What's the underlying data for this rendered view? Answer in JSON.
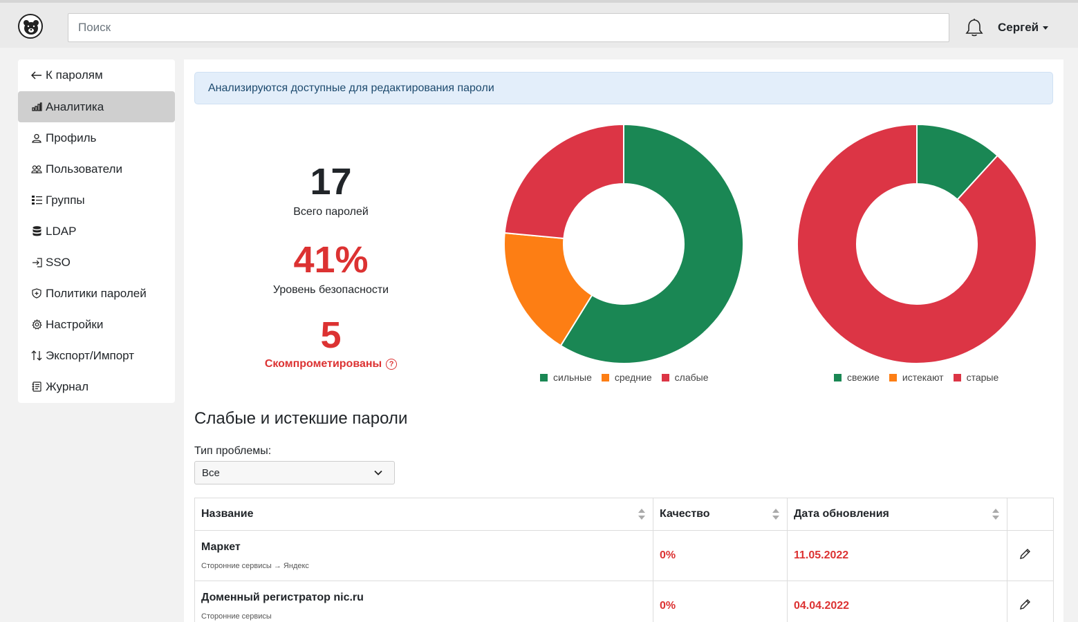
{
  "header": {
    "search_placeholder": "Поиск",
    "user_name": "Сергей"
  },
  "sidebar": {
    "items": [
      {
        "label": "К паролям",
        "icon": "arrow-left-icon"
      },
      {
        "label": "Аналитика",
        "icon": "bar-chart-icon",
        "active": true
      },
      {
        "label": "Профиль",
        "icon": "user-icon"
      },
      {
        "label": "Пользователи",
        "icon": "users-icon"
      },
      {
        "label": "Группы",
        "icon": "list-icon"
      },
      {
        "label": "LDAP",
        "icon": "database-icon"
      },
      {
        "label": "SSO",
        "icon": "login-icon"
      },
      {
        "label": "Политики паролей",
        "icon": "shield-icon"
      },
      {
        "label": "Настройки",
        "icon": "gear-icon"
      },
      {
        "label": "Экспорт/Импорт",
        "icon": "arrows-updown-icon"
      },
      {
        "label": "Журнал",
        "icon": "journal-icon"
      }
    ]
  },
  "alert": "Анализируются доступные для редактирования пароли",
  "stats": {
    "total_value": "17",
    "total_label": "Всего паролей",
    "security_value": "41%",
    "security_label": "Уровень безопасности",
    "compromised_value": "5",
    "compromised_label": "Скомпрометированы"
  },
  "colors": {
    "green": "#1a8754",
    "orange": "#fd7e14",
    "red": "#dc3545"
  },
  "chart_data": [
    {
      "type": "pie",
      "categories": [
        "сильные",
        "средние",
        "слабые"
      ],
      "values": [
        10,
        3,
        4
      ]
    },
    {
      "type": "pie",
      "categories": [
        "свежие",
        "истекают",
        "старые"
      ],
      "values": [
        2,
        0,
        15
      ]
    }
  ],
  "weak": {
    "title": "Слабые и истекшие пароли",
    "filter_label": "Тип проблемы:",
    "filter_value": "Все",
    "columns": [
      "Название",
      "Качество",
      "Дата обновления"
    ],
    "rows": [
      {
        "name": "Маркет",
        "path": "Сторонние сервисы → Яндекс",
        "quality": "0%",
        "date": "11.05.2022"
      },
      {
        "name": "Доменный регистратор nic.ru",
        "path": "Сторонние сервисы",
        "quality": "0%",
        "date": "04.04.2022"
      }
    ]
  }
}
